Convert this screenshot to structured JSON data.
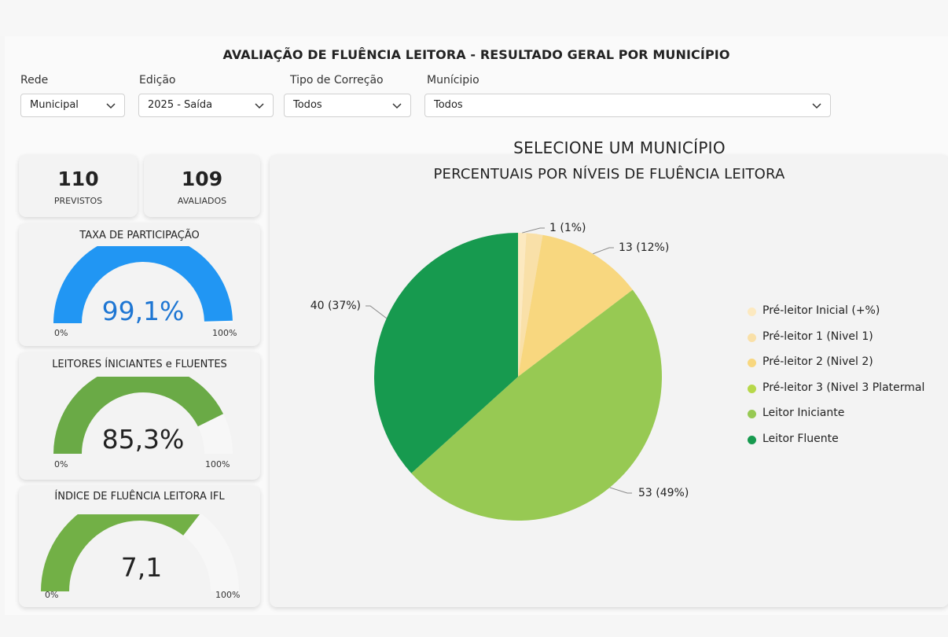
{
  "title": "AVALIAÇÃO DE FLUÊNCIA LEITORA - RESULTADO GERAL POR MUNICÍPIO",
  "filters": [
    {
      "label": "Rede",
      "value": "Municipal"
    },
    {
      "label": "Edição",
      "value": "2025 - Saída"
    },
    {
      "label": "Tipo de Correção",
      "value": "Todos"
    },
    {
      "label": "Munícipio",
      "value": "Todos"
    }
  ],
  "kpis": {
    "previstos": {
      "value": "110",
      "label": "PREVISTOS"
    },
    "avaliados": {
      "value": "109",
      "label": "AVALIADOS"
    }
  },
  "gauges": [
    {
      "title": "TAXA DE PARTICIPAÇÃO",
      "value_text": "99,1%",
      "fraction": 0.991,
      "color": "#2196f3",
      "value_color": "#1e76d3",
      "min": "0%",
      "max": "100%"
    },
    {
      "title": "LEITORES ÍNICIANTES e FLUENTES",
      "value_text": "85,3%",
      "fraction": 0.853,
      "color": "#6aaa46",
      "value_color": "#222222",
      "min": "0%",
      "max": "100%"
    },
    {
      "title": "ÍNDICE DE FLUÊNCIA LEITORA IFL",
      "value_text": "7,1",
      "fraction": 0.71,
      "color": "#72b046",
      "value_color": "#222222",
      "min": "0%",
      "max": "100%"
    }
  ],
  "select_heading": "SELECIONE UM MUNICÍPIO",
  "chart_data": {
    "type": "pie",
    "title": "PERCENTUAIS POR NÍVEIS DE FLUÊNCIA LEITORA",
    "slices": [
      {
        "name": "Pré-leitor Inicial (+%)",
        "value": 1,
        "label": "1 (1%)",
        "color": "#fce9c0"
      },
      {
        "name": "Pré-leitor 1 (Nivel 1)",
        "value": 2,
        "label": "",
        "color": "#f9e0a8"
      },
      {
        "name": "Pré-leitor 2 (Nivel 2)",
        "value": 13,
        "label": "13 (12%)",
        "color": "#f8d77f"
      },
      {
        "name": "Pré-leitor 3 (Nivel 3 Platermal",
        "value": 0,
        "label": "",
        "color": "#b7d84a"
      },
      {
        "name": "Leitor Iniciante",
        "value": 53,
        "label": "53 (49%)",
        "color": "#97c953"
      },
      {
        "name": "Leitor Fluente",
        "value": 40,
        "label": "40 (37%)",
        "color": "#179a4f"
      }
    ],
    "legend_position": "right"
  }
}
